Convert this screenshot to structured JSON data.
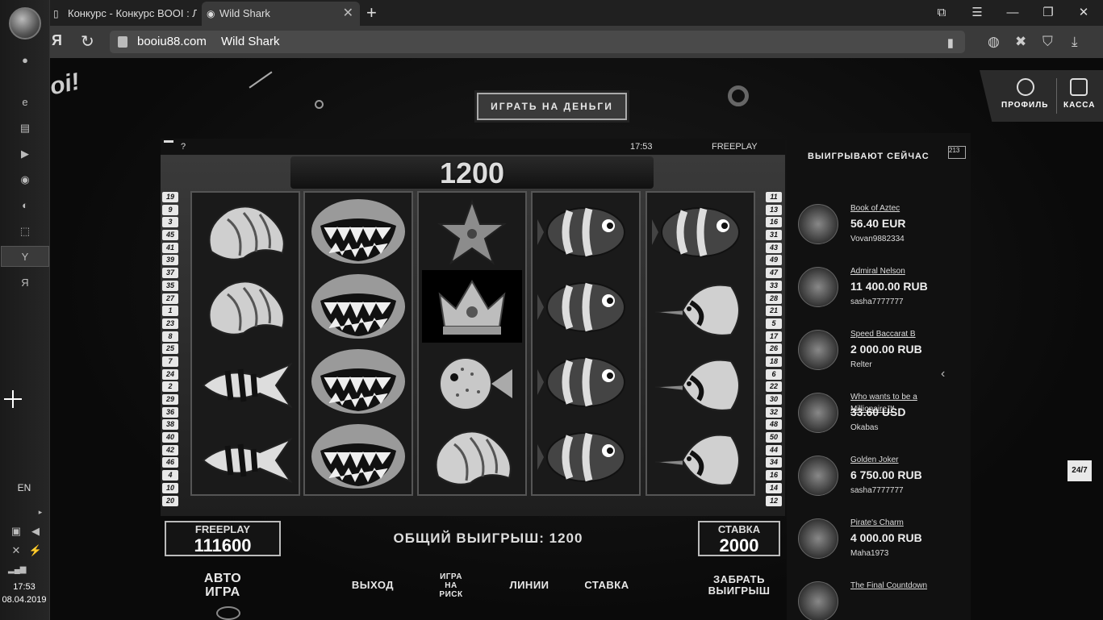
{
  "taskbar": {
    "lang": "EN",
    "time": "17:53",
    "date": "08.04.2019"
  },
  "browser": {
    "tabs": [
      {
        "title": "Конкурс - Конкурс BOOI : Л"
      },
      {
        "title": "Wild Shark"
      }
    ],
    "address": {
      "host": "booiu88.com",
      "page_title": "Wild Shark"
    }
  },
  "header": {
    "play_money_label": "ИГРАТЬ НА ДЕНЬГИ",
    "profile_label": "ПРОФИЛЬ",
    "cashier_label": "КАССА"
  },
  "slot": {
    "help": "?",
    "clock": "17:53",
    "mode": "FREEPLAY",
    "win_display": "1200",
    "lines_left": [
      "19",
      "9",
      "3",
      "45",
      "41",
      "39",
      "37",
      "35",
      "27",
      "1",
      "23",
      "8",
      "25",
      "7",
      "24",
      "2",
      "29",
      "36",
      "38",
      "40",
      "42",
      "46",
      "4",
      "10",
      "20"
    ],
    "lines_right": [
      "11",
      "13",
      "16",
      "31",
      "43",
      "49",
      "47",
      "33",
      "28",
      "21",
      "5",
      "17",
      "26",
      "18",
      "6",
      "22",
      "30",
      "32",
      "48",
      "50",
      "44",
      "34",
      "16",
      "14",
      "12"
    ],
    "reels": [
      [
        "shell",
        "shell",
        "angelfish",
        "angelfish"
      ],
      [
        "shark",
        "shark",
        "shark",
        "shark"
      ],
      [
        "starfish",
        "crown",
        "pufferfish",
        "shell"
      ],
      [
        "clownfish",
        "clownfish",
        "clownfish",
        "clownfish"
      ],
      [
        "clownfish",
        "butterflyfish",
        "butterflyfish",
        "butterflyfish"
      ]
    ],
    "balance": {
      "label": "FREEPLAY",
      "value": "111600"
    },
    "bet": {
      "label": "СТАВКА",
      "value": "2000"
    },
    "total_win": "ОБЩИЙ ВЫИГРЫШ: 1200",
    "controls": {
      "auto": "АВТО ИГРА",
      "exit": "ВЫХОД",
      "gamble": "ИГРА НА РИСК",
      "lines": "ЛИНИИ",
      "stake": "СТАВКА",
      "collect": "ЗАБРАТЬ ВЫИГРЫШ"
    }
  },
  "winners": {
    "title": "ВЫИГРЫВАЮТ СЕЙЧАС",
    "podium": "213",
    "items": [
      {
        "game": "Book of Aztec",
        "amount": "56.40 EUR",
        "user": "Vovan9882334"
      },
      {
        "game": "Admiral Nelson",
        "amount": "11 400.00 RUB",
        "user": "sasha7777777"
      },
      {
        "game": "Speed Baccarat B",
        "amount": "2 000.00 RUB",
        "user": "Relter"
      },
      {
        "game": "Who wants to be a Millionaire™",
        "amount": "33.60 USD",
        "user": "Okabas"
      },
      {
        "game": "Golden Joker",
        "amount": "6 750.00 RUB",
        "user": "sasha7777777"
      },
      {
        "game": "Pirate's Charm",
        "amount": "4 000.00 RUB",
        "user": "Maha1973"
      },
      {
        "game": "The Final Countdown",
        "amount": "",
        "user": ""
      }
    ]
  },
  "support": {
    "label": "24/7"
  }
}
